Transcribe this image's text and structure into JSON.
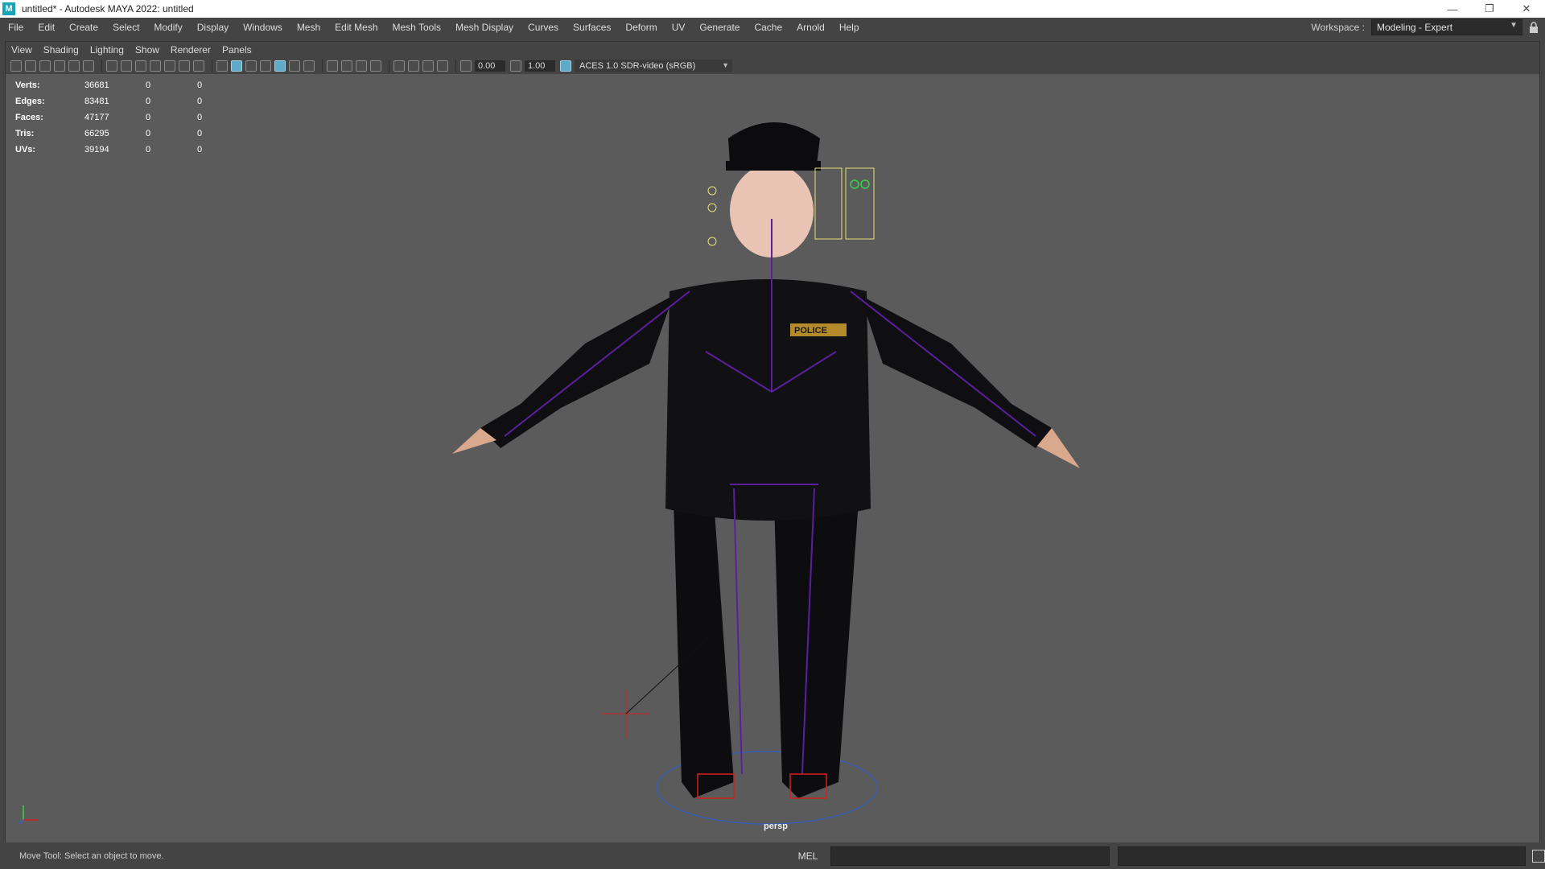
{
  "window": {
    "title": "untitled* - Autodesk MAYA 2022: untitled",
    "logo_letter": "M",
    "minimize": "—",
    "restore": "❐",
    "close": "✕"
  },
  "main_menu": [
    "File",
    "Edit",
    "Create",
    "Select",
    "Modify",
    "Display",
    "Windows",
    "Mesh",
    "Edit Mesh",
    "Mesh Tools",
    "Mesh Display",
    "Curves",
    "Surfaces",
    "Deform",
    "UV",
    "Generate",
    "Cache",
    "Arnold",
    "Help"
  ],
  "workspace": {
    "label": "Workspace :",
    "value": "Modeling - Expert",
    "arrow": "▼"
  },
  "panel_menu": [
    "View",
    "Shading",
    "Lighting",
    "Show",
    "Renderer",
    "Panels"
  ],
  "panel_toolbar": {
    "exposure": "0.00",
    "gamma": "1.00",
    "color_space": "ACES 1.0 SDR-video (sRGB)",
    "arrow": "▼"
  },
  "heads_up": [
    {
      "label": "Verts:",
      "total": "36681",
      "selected": "0",
      "selected_components": "0"
    },
    {
      "label": "Edges:",
      "total": "83481",
      "selected": "0",
      "selected_components": "0"
    },
    {
      "label": "Faces:",
      "total": "47177",
      "selected": "0",
      "selected_components": "0"
    },
    {
      "label": "Tris:",
      "total": "66295",
      "selected": "0",
      "selected_components": "0"
    },
    {
      "label": "UVs:",
      "total": "39194",
      "selected": "0",
      "selected_components": "0"
    }
  ],
  "viewport": {
    "camera": "persp",
    "badge_text": "POLICE"
  },
  "status": {
    "help_line": "Move Tool: Select an object to move.",
    "script_type": "MEL"
  }
}
